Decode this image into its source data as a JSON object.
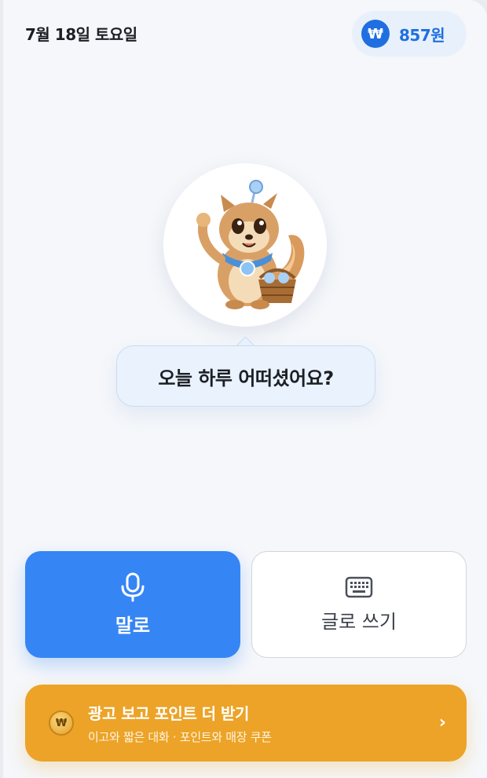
{
  "header": {
    "date": "7월 18일 토요일",
    "points_symbol": "₩",
    "points_value": "857원"
  },
  "mascot": {
    "icon": "squirrel-mascot"
  },
  "prompt": {
    "question": "오늘 하루 어떠셨어요?"
  },
  "actions": {
    "speak_label": "말로",
    "speak_icon": "microphone-icon",
    "write_label": "글로 쓰기",
    "write_icon": "keyboard-icon"
  },
  "ad_banner": {
    "coin_symbol": "₩",
    "title": "광고 보고 포인트 더 받기",
    "subtitle": "이고와 짧은 대화 · 포인트와 매장 쿠폰",
    "chevron": "›"
  },
  "colors": {
    "primary": "#3585F5",
    "points_blue": "#1F6FE0",
    "ad_orange": "#ECA327",
    "background": "#F5F7FA"
  }
}
